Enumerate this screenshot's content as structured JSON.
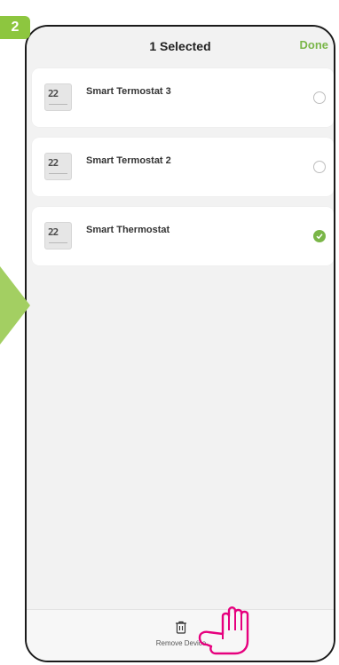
{
  "step": {
    "number": "2"
  },
  "header": {
    "title": "1 Selected",
    "done_label": "Done"
  },
  "devices": [
    {
      "name": "Smart Termostat 3",
      "display": "22",
      "selected": false
    },
    {
      "name": "Smart Termostat 2",
      "display": "22",
      "selected": false
    },
    {
      "name": "Smart Thermostat",
      "display": "22",
      "selected": true
    }
  ],
  "bottom": {
    "remove_label": "Remove Device",
    "icon": "trash-icon"
  },
  "colors": {
    "accent": "#7ab648",
    "badge": "#8dc63f",
    "pointer": "#e6007e"
  }
}
